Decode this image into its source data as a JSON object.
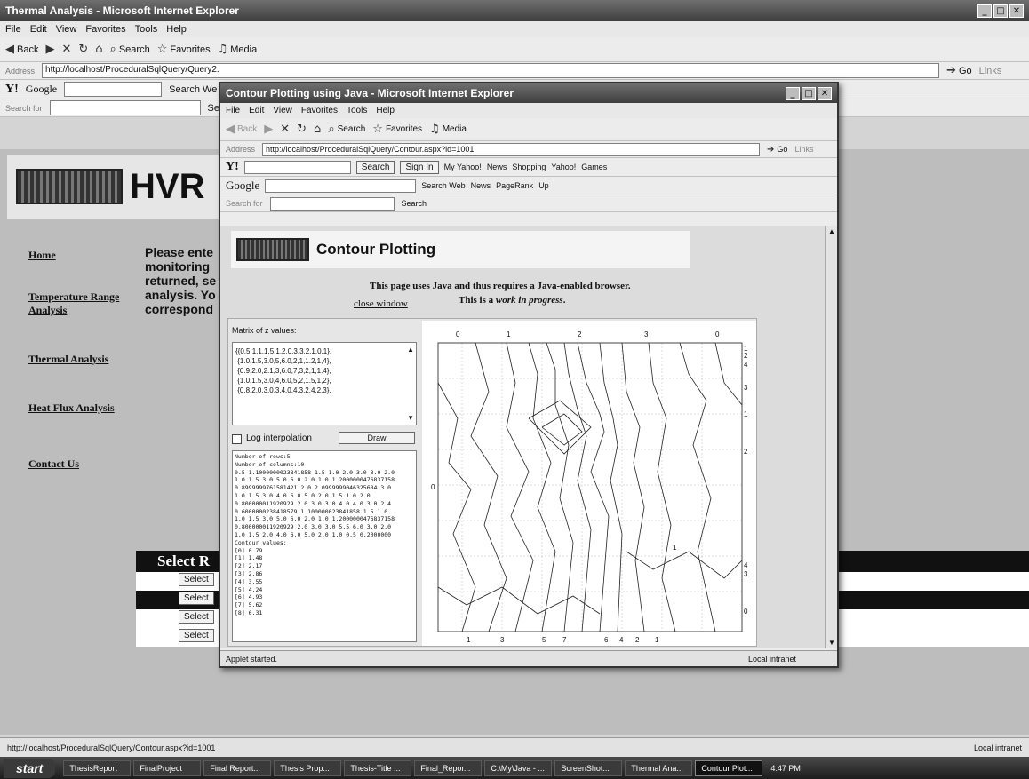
{
  "back_window": {
    "title": "Thermal Analysis - Microsoft Internet Explorer",
    "menu": [
      "File",
      "Edit",
      "View",
      "Favorites",
      "Tools",
      "Help"
    ],
    "toolbar": {
      "back": "Back",
      "search": "Search",
      "favorites": "Favorites",
      "media": "Media"
    },
    "address_label": "Address",
    "address": "http://localhost/ProceduralSqlQuery/Query2.",
    "go": "Go",
    "links": "Links",
    "google_label": "Google",
    "search_web": "Search We",
    "search_for": "Search for",
    "search_btn": "Searc",
    "site_title": "HVR",
    "nav": [
      "Home",
      "Temperature Range Analysis",
      "Thermal Analysis",
      "Heat Flux Analysis",
      "Contact Us"
    ],
    "intro_lines": [
      "Please ente",
      "monitoring",
      "returned, se",
      "analysis. Yo",
      "correspond"
    ],
    "select_heading": "Select R",
    "select_buttons": [
      "Select",
      "Select",
      "Select",
      "Select"
    ],
    "status_url": "http://localhost/ProceduralSqlQuery/Contour.aspx?id=1001",
    "status_zone": "Local intranet"
  },
  "front_window": {
    "title": "Contour Plotting using Java - Microsoft Internet Explorer",
    "menu": [
      "File",
      "Edit",
      "View",
      "Favorites",
      "Tools",
      "Help"
    ],
    "toolbar": {
      "back": "Back",
      "search": "Search",
      "favorites": "Favorites",
      "media": "Media"
    },
    "address_label": "Address",
    "address": "http://localhost/ProceduralSqlQuery/Contour.aspx?id=1001",
    "go": "Go",
    "links": "Links",
    "yahoo": {
      "search": "Search",
      "sign_in": "Sign In",
      "my_yahoo": "My Yahoo!",
      "news": "News",
      "shopping": "Shopping",
      "yahoo": "Yahoo!",
      "games": "Games"
    },
    "google": {
      "label": "Google",
      "search_web": "Search Web",
      "news": "News",
      "pagerank": "PageRank",
      "up": "Up"
    },
    "search_for": "Search for",
    "search_btn": "Search",
    "page_title": "Contour Plotting",
    "java_notice": "This page uses Java and thus requires a Java-enabled browser.",
    "progress_prefix": "This is a ",
    "progress_em": "work in progress",
    "progress_suffix": ".",
    "close_window": "close window",
    "matrix_label": "Matrix of z values:",
    "matrix_text": "{{0.5,1.1,1.5,1,2.0,3,3,2,1,0.1},\n {1.0,1.5,3.0,5,6.0,2,1,1.2,1,4},\n {0.9,2.0,2.1,3,6.0,7,3,2,1,1.4},\n {1.0,1.5,3.0,4,6.0,5,2,1.5,1,2},\n {0.8,2.0,3.0,3,4.0,4,3,2.4,2,3},",
    "log_label": "Log interpolation",
    "draw": "Draw",
    "output_text": "Number of rows:5\nNumber of columns:10\n0.5 1.1000000023841858 1.5 1.0 2.0 3.0 3.0 2.0\n1.0 1.5 3.0 5.0 6.0 2.0 1.0 1.2000000476837158\n0.8999999761581421 2.0 2.0999999046325684 3.0\n1.0 1.5 3.0 4.0 6.0 5.0 2.0 1.5 1.0 2.0\n0.800000011920929 2.0 3.0 3.0 4.0 4.0 3.0 2.4\n0.6000000238418579 1.100000023841858 1.5 1.0\n1.0 1.5 3.0 5.0 6.0 2.0 1.0 1.2000000476837158\n0.800000011920929 2.0 3.0 3.0 5.5 6.0 3.0 2.0\n1.0 1.5 2.0 4.0 6.0 5.0 2.0 1.0 0.5 0.2000000\nContour values:\n[0] 0.79\n[1] 1.48\n[2] 2.17\n[3] 2.86\n[4] 3.55\n[5] 4.24\n[6] 4.93\n[7] 5.62\n[8] 6.31",
    "status_left": "Applet started.",
    "status_zone": "Local intranet",
    "plot_top_labels": [
      "0",
      "1",
      "2",
      "3",
      "0"
    ],
    "plot_bottom_labels": [
      "1",
      "3",
      "5",
      "7",
      "6",
      "4",
      "2",
      "1"
    ],
    "plot_right_labels": [
      "1",
      "2",
      "4",
      "3",
      "1",
      "2",
      "4",
      "3",
      "0"
    ],
    "plot_inner_labels": [
      "0",
      "1"
    ]
  },
  "taskbar": {
    "start": "start",
    "items": [
      "ThesisReport",
      "FinalProject",
      "Final Report...",
      "Thesis Prop...",
      "Thesis-Title ...",
      "Final_Repor...",
      "C:\\My\\Java - ...",
      "ScreenShot...",
      "Thermal Ana...",
      "Contour Plot..."
    ],
    "clock": "4:47 PM"
  }
}
